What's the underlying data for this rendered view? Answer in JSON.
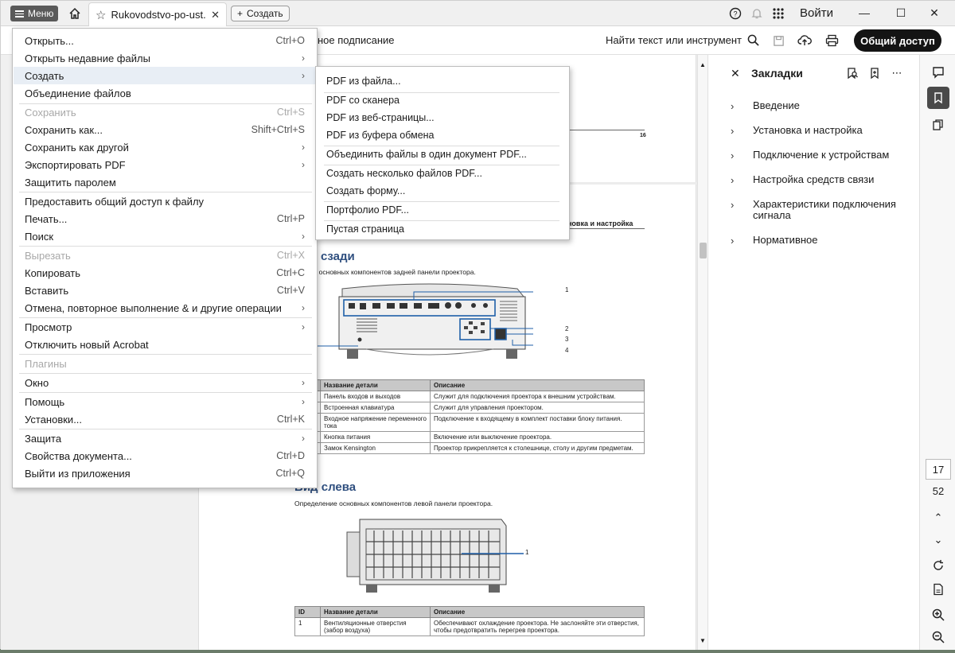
{
  "titlebar": {
    "menu_label": "Меню",
    "tab_title": "Rukovodstvo-po-ust...",
    "new_tab_label": "Создать",
    "login_label": "Войти"
  },
  "toolbar": {
    "partial_label": "ное подписание",
    "search_tool_label": "Найти текст или инструмент",
    "share_label": "Общий доступ"
  },
  "main_menu": [
    {
      "label": "Открыть...",
      "shortcut": "Ctrl+O",
      "arrow": false,
      "disabled": false
    },
    {
      "label": "Открыть недавние файлы",
      "shortcut": "",
      "arrow": true,
      "disabled": false
    },
    {
      "label": "Создать",
      "shortcut": "",
      "arrow": true,
      "disabled": false,
      "highlight": true
    },
    {
      "label": "Объединение файлов",
      "shortcut": "",
      "arrow": false,
      "disabled": false
    },
    {
      "label": "Сохранить",
      "shortcut": "Ctrl+S",
      "arrow": false,
      "disabled": true
    },
    {
      "label": "Сохранить как...",
      "shortcut": "Shift+Ctrl+S",
      "arrow": false,
      "disabled": false
    },
    {
      "label": "Сохранить как другой",
      "shortcut": "",
      "arrow": true,
      "disabled": false
    },
    {
      "label": "Экспортировать PDF",
      "shortcut": "",
      "arrow": true,
      "disabled": false
    },
    {
      "label": "Защитить паролем",
      "shortcut": "",
      "arrow": false,
      "disabled": false
    },
    {
      "label": "Предоставить общий доступ к файлу",
      "shortcut": "",
      "arrow": false,
      "disabled": false
    },
    {
      "label": "Печать...",
      "shortcut": "Ctrl+P",
      "arrow": false,
      "disabled": false
    },
    {
      "label": "Поиск",
      "shortcut": "",
      "arrow": true,
      "disabled": false
    },
    {
      "label": "Вырезать",
      "shortcut": "Ctrl+X",
      "arrow": false,
      "disabled": true
    },
    {
      "label": "Копировать",
      "shortcut": "Ctrl+C",
      "arrow": false,
      "disabled": false
    },
    {
      "label": "Вставить",
      "shortcut": "Ctrl+V",
      "arrow": false,
      "disabled": false
    },
    {
      "label": "Отмена, повторное выполнение & и другие операции",
      "shortcut": "",
      "arrow": true,
      "disabled": false
    },
    {
      "label": "Просмотр",
      "shortcut": "",
      "arrow": true,
      "disabled": false
    },
    {
      "label": "Отключить новый Acrobat",
      "shortcut": "",
      "arrow": false,
      "disabled": false
    },
    {
      "label": "Плагины",
      "shortcut": "",
      "arrow": false,
      "disabled": true
    },
    {
      "label": "Окно",
      "shortcut": "",
      "arrow": true,
      "disabled": false
    },
    {
      "label": "Помощь",
      "shortcut": "",
      "arrow": true,
      "disabled": false
    },
    {
      "label": "Установки...",
      "shortcut": "Ctrl+K",
      "arrow": false,
      "disabled": false
    },
    {
      "label": "Защита",
      "shortcut": "",
      "arrow": true,
      "disabled": false
    },
    {
      "label": "Свойства документа...",
      "shortcut": "Ctrl+D",
      "arrow": false,
      "disabled": false
    },
    {
      "label": "Выйти из приложения",
      "shortcut": "Ctrl+Q",
      "arrow": false,
      "disabled": false
    }
  ],
  "create_submenu": [
    "PDF из файла...",
    "PDF со сканера",
    "PDF из веб-страницы...",
    "PDF из буфера обмена",
    "Объединить файлы в один документ PDF...",
    "Создать несколько файлов PDF...",
    "Создать форму...",
    "Портфолио PDF...",
    "Пустая страница"
  ],
  "bookmarks": {
    "title": "Закладки",
    "items": [
      "Введение",
      "Установка и настройка",
      "Подключение к устройствам",
      "Настройка средств связи",
      "Характеристики подключения сигнала",
      "Нормативное"
    ]
  },
  "page_nav": {
    "current": "17",
    "total": "52"
  },
  "document": {
    "page_number": "16",
    "running_head": "новка и настройка",
    "rear_heading": "сзади",
    "rear_text": "еление основных компонентов задней панели проектора.",
    "callouts_rear": [
      "1",
      "2",
      "3",
      "4"
    ],
    "table_rear": {
      "headers": [
        "Название детали",
        "Описание"
      ],
      "rows": [
        [
          "Панель входов и выходов",
          "Служит для подключения проектора к внешним устройствам."
        ],
        [
          "Встроенная клавиатура",
          "Служит для управления проектором."
        ],
        [
          "Входное напряжение переменного тока",
          "Подключение к входящему в комплект поставки блоку питания."
        ],
        [
          "Кнопка питания",
          "Включение или выключение проектора."
        ],
        [
          "Замок Kensington",
          "Проектор прикрепляется к столешнице, столу и другим предметам."
        ]
      ]
    },
    "left_heading": "Вид слева",
    "left_text": "Определение основных компонентов левой панели проектора.",
    "callouts_left": [
      "1"
    ],
    "table_left": {
      "headers": [
        "ID",
        "Название детали",
        "Описание"
      ],
      "rows": [
        [
          "1",
          "Вентиляционные отверстия (забор воздуха)",
          "Обеспечивают охлаждение проектора. Не заслоняйте эти отверстия, чтобы предотвратить перегрев проектора."
        ]
      ]
    }
  }
}
